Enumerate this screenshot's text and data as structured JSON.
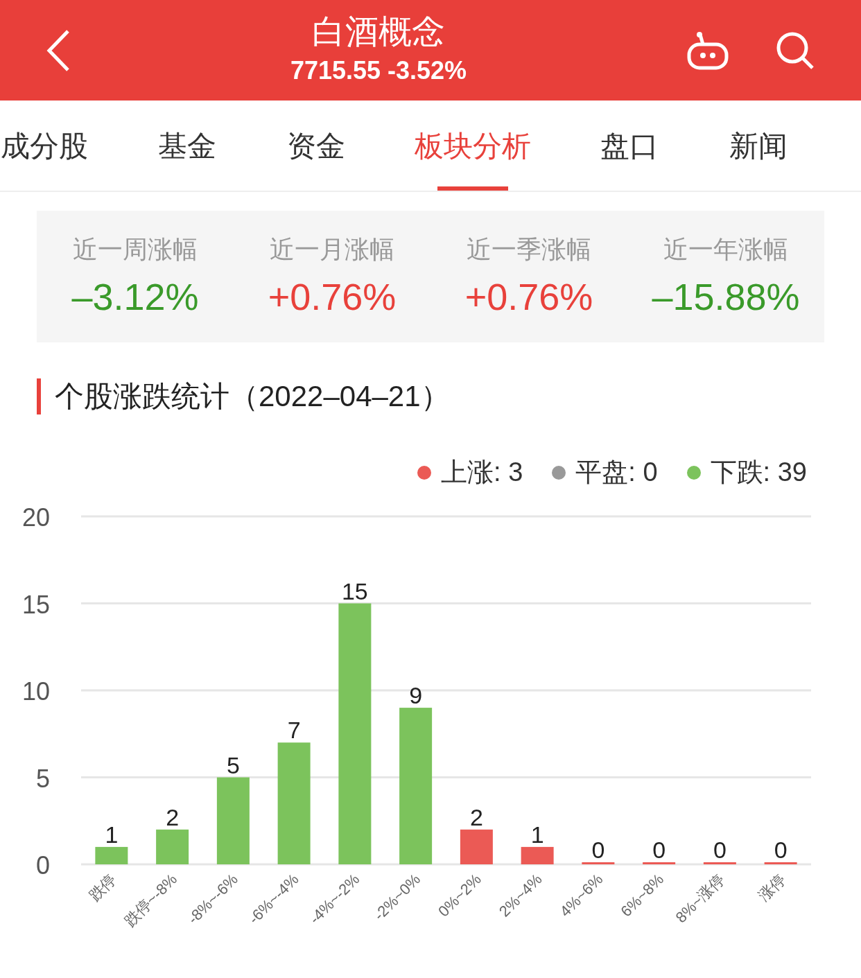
{
  "header": {
    "title": "白酒概念",
    "subtitle": "7715.55 -3.52%"
  },
  "tabs": [
    {
      "label": "成分股",
      "selected": false
    },
    {
      "label": "基金",
      "selected": false
    },
    {
      "label": "资金",
      "selected": false
    },
    {
      "label": "板块分析",
      "selected": true
    },
    {
      "label": "盘口",
      "selected": false
    },
    {
      "label": "新闻",
      "selected": false
    }
  ],
  "stats": [
    {
      "label": "近一周涨幅",
      "value": "–3.12%",
      "color": "#3a9a2a"
    },
    {
      "label": "近一月涨幅",
      "value": "+0.76%",
      "color": "#e8413b"
    },
    {
      "label": "近一季涨幅",
      "value": "+0.76%",
      "color": "#e8413b"
    },
    {
      "label": "近一年涨幅",
      "value": "–15.88%",
      "color": "#3a9a2a"
    }
  ],
  "section": {
    "title": "个股涨跌统计（2022–04–21）"
  },
  "legend": [
    {
      "label": "上涨: 3",
      "color": "#eb5a55"
    },
    {
      "label": "平盘: 0",
      "color": "#999999"
    },
    {
      "label": "下跌: 39",
      "color": "#7cc35c"
    }
  ],
  "chart_data": {
    "type": "bar",
    "categories": [
      "跌停",
      "跌停~-8%",
      "-8%~-6%",
      "-6%~-4%",
      "-4%~-2%",
      "-2%~0%",
      "0%~2%",
      "2%~4%",
      "4%~6%",
      "6%~8%",
      "8%~涨停",
      "涨停"
    ],
    "series": [
      {
        "color": "#7cc35c",
        "values": [
          1,
          2,
          5,
          7,
          15,
          9,
          null,
          null,
          null,
          null,
          null,
          null
        ]
      },
      {
        "color": "#eb5a55",
        "values": [
          null,
          null,
          null,
          null,
          null,
          null,
          2,
          1,
          0,
          0,
          0,
          0
        ]
      }
    ],
    "ylim": [
      0,
      20
    ],
    "yticks": [
      0,
      5,
      10,
      15,
      20
    ],
    "data_labels": true,
    "grid": true
  }
}
